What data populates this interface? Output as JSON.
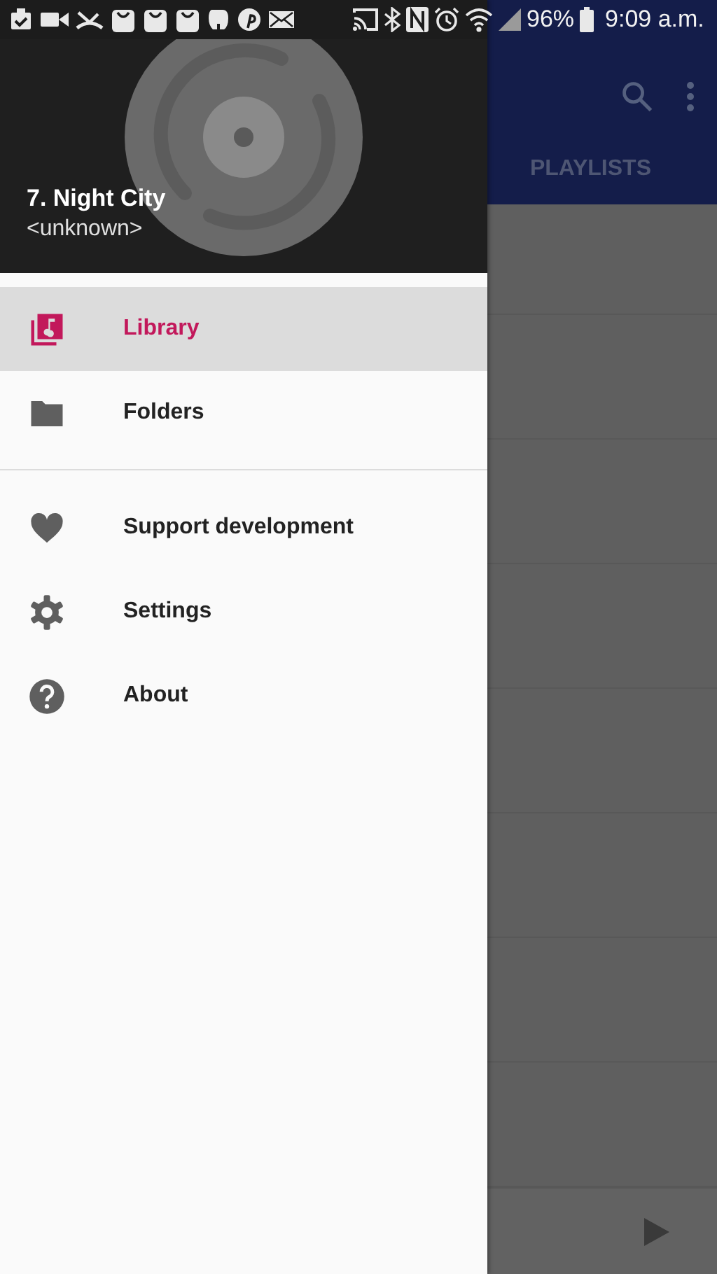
{
  "status_bar": {
    "battery": "96%",
    "time": "9:09 a.m."
  },
  "background_app": {
    "tab_label": "PLAYLISTS",
    "rows": [
      {
        "kind": "plain"
      },
      {
        "kind": "menu"
      },
      {
        "kind": "menu"
      },
      {
        "kind": "menu"
      },
      {
        "kind": "menu"
      },
      {
        "kind": "menu"
      },
      {
        "kind": "menu"
      },
      {
        "kind": "menu"
      }
    ],
    "mini_player": {
      "playing": false
    }
  },
  "drawer": {
    "now_playing": {
      "title": "7. Night City",
      "artist": "<unknown>"
    },
    "sections": [
      [
        {
          "kind": "library",
          "label": "Library",
          "selected": true
        },
        {
          "kind": "folder",
          "label": "Folders",
          "selected": false
        }
      ],
      [
        {
          "kind": "heart",
          "label": "Support development",
          "selected": false
        },
        {
          "kind": "gear",
          "label": "Settings",
          "selected": false
        },
        {
          "kind": "help",
          "label": "About",
          "selected": false
        }
      ]
    ]
  }
}
